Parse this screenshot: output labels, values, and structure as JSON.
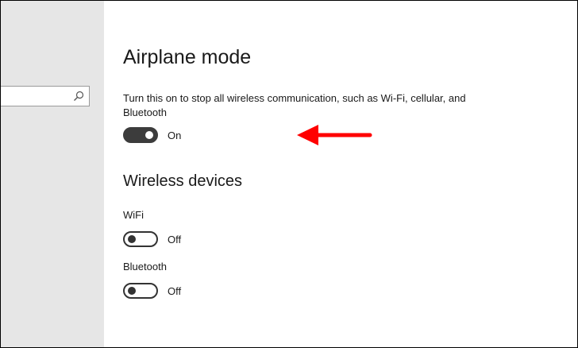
{
  "airplane": {
    "title": "Airplane mode",
    "description": "Turn this on to stop all wireless communication, such as Wi-Fi, cellular, and Bluetooth",
    "toggle_state": "On"
  },
  "wireless": {
    "title": "Wireless devices",
    "devices": [
      {
        "label": "WiFi",
        "toggle_state": "Off"
      },
      {
        "label": "Bluetooth",
        "toggle_state": "Off"
      }
    ]
  },
  "icons": {
    "search": "search-icon",
    "annotation": "red-arrow-icon"
  },
  "colors": {
    "sidebar_bg": "#e6e6e6",
    "toggle_on": "#3c3c3c",
    "annotation_arrow": "#ff0000"
  }
}
